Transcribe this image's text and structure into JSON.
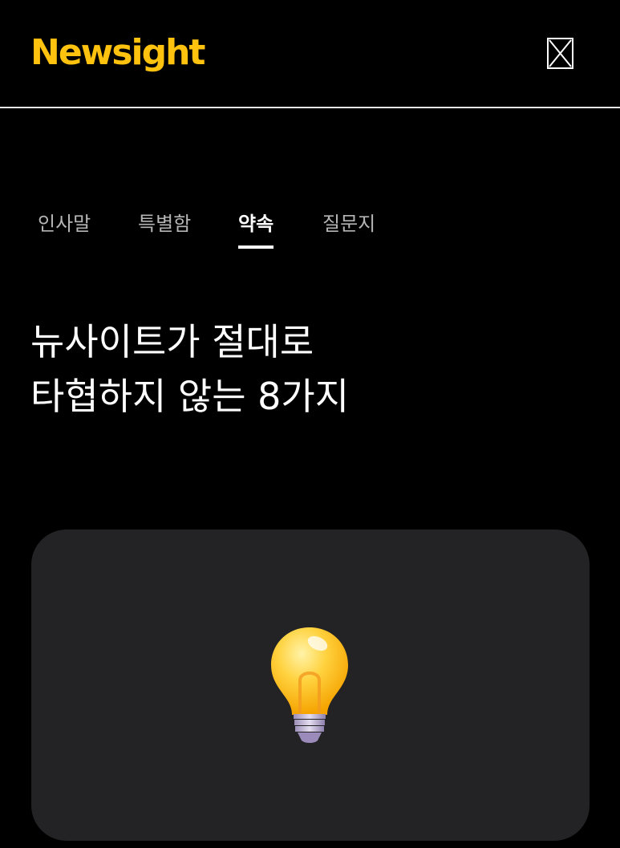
{
  "header": {
    "logo_text": "Newsight",
    "close_icon": "close-box-icon",
    "accent_color": "#ffc20e"
  },
  "tabs": [
    {
      "label": "인사말",
      "active": false
    },
    {
      "label": "특별함",
      "active": false
    },
    {
      "label": "약속",
      "active": true
    },
    {
      "label": "질문지",
      "active": false
    }
  ],
  "headline": {
    "line1": "뉴사이트가 절대로",
    "line2": "타협하지 않는 8가지"
  },
  "card": {
    "icon": "light-bulb-icon",
    "background_color": "#232325"
  }
}
